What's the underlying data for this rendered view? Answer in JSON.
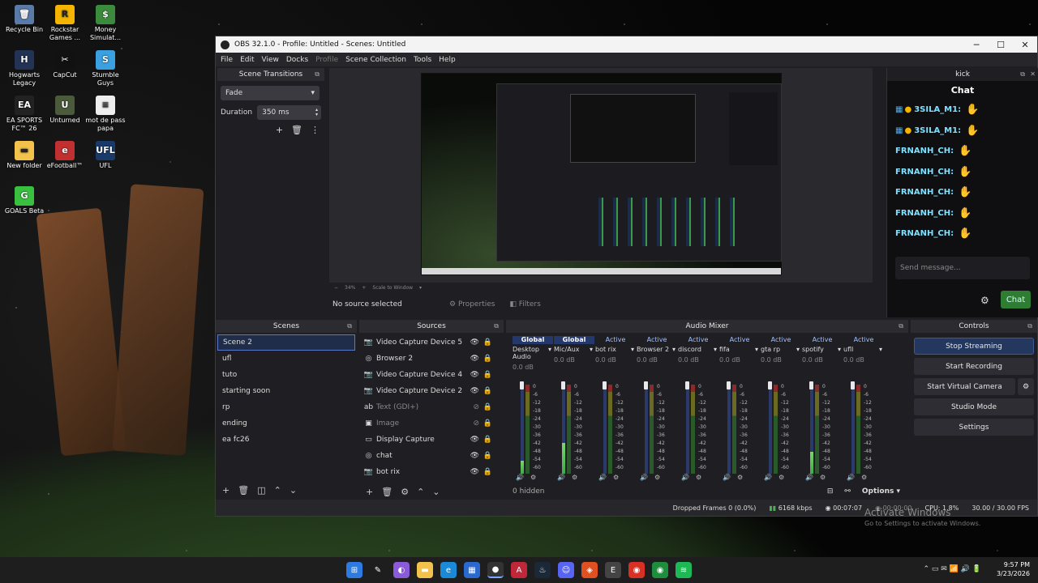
{
  "desktop": {
    "icons": [
      {
        "label": "Recycle Bin",
        "icon": "recycle-bin-icon",
        "color": "#5a7aa8",
        "glyph": "🗑"
      },
      {
        "label": "Rockstar Games ...",
        "icon": "rockstar-icon",
        "color": "#f4b400",
        "glyph": "R"
      },
      {
        "label": "Money Simulat...",
        "icon": "money-icon",
        "color": "#3c8a3c",
        "glyph": "$"
      },
      {
        "label": "Hogwarts Legacy",
        "icon": "hogwarts-icon",
        "color": "#223355",
        "glyph": "H"
      },
      {
        "label": "CapCut",
        "icon": "capcut-icon",
        "color": "#111111",
        "glyph": "✂"
      },
      {
        "label": "Stumble Guys",
        "icon": "stumble-icon",
        "color": "#3aa0e0",
        "glyph": "S"
      },
      {
        "label": "EA SPORTS FC™ 26",
        "icon": "ea-icon",
        "color": "#222222",
        "glyph": "EA"
      },
      {
        "label": "Unturned",
        "icon": "unturned-icon",
        "color": "#4a5a3a",
        "glyph": "U"
      },
      {
        "label": "mot de pass papa",
        "icon": "document-icon",
        "color": "#eeeeee",
        "glyph": "≡"
      },
      {
        "label": "New folder",
        "icon": "folder-icon",
        "color": "#f2c24c",
        "glyph": "▬"
      },
      {
        "label": "eFootball™",
        "icon": "efootball-icon",
        "color": "#c03030",
        "glyph": "e"
      },
      {
        "label": "UFL",
        "icon": "ufl-icon",
        "color": "#1a3a6a",
        "glyph": "UFL"
      },
      {
        "label": "GOALS Beta",
        "icon": "goals-icon",
        "color": "#3ac040",
        "glyph": "G"
      }
    ]
  },
  "window": {
    "title": "OBS 32.1.0 - Profile: Untitled - Scenes: Untitled",
    "controls": {
      "minimize": "─",
      "maximize": "☐",
      "close": "✕"
    }
  },
  "menu": [
    "File",
    "Edit",
    "View",
    "Docks",
    "Profile",
    "Scene Collection",
    "Tools",
    "Help"
  ],
  "transitions": {
    "title": "Scene Transitions",
    "type": "Fade",
    "duration_label": "Duration",
    "duration": "350 ms"
  },
  "preview": {
    "zoom": "34%",
    "scale_mode": "Scale to Window"
  },
  "context": {
    "no_source": "No source selected",
    "properties": "Properties",
    "filters": "Filters"
  },
  "scenes": {
    "title": "Scenes",
    "items": [
      "Scene 2",
      "ufl",
      "tuto",
      "starting soon",
      "rp",
      "ending",
      "ea fc26"
    ],
    "selected": 0
  },
  "sources": {
    "title": "Sources",
    "items": [
      {
        "name": "Video Capture Device 5",
        "icon": "camera-icon",
        "glyph": "📷",
        "visible": true
      },
      {
        "name": "Browser 2",
        "icon": "globe-icon",
        "glyph": "◎",
        "visible": true
      },
      {
        "name": "Video Capture Device 4",
        "icon": "camera-icon",
        "glyph": "📷",
        "visible": true
      },
      {
        "name": "Video Capture Device 2",
        "icon": "camera-icon",
        "glyph": "📷",
        "visible": true
      },
      {
        "name": "Text (GDI+)",
        "icon": "text-icon",
        "glyph": "ab",
        "visible": false
      },
      {
        "name": "Image",
        "icon": "image-icon",
        "glyph": "▣",
        "visible": false
      },
      {
        "name": "Display Capture",
        "icon": "display-icon",
        "glyph": "▭",
        "visible": true
      },
      {
        "name": "chat",
        "icon": "globe-icon",
        "glyph": "◎",
        "visible": true
      },
      {
        "name": "bot rix",
        "icon": "camera-icon",
        "glyph": "📷",
        "visible": true
      }
    ]
  },
  "mixer": {
    "title": "Audio Mixer",
    "hidden": "0 hidden",
    "options": "Options",
    "ticks": [
      "0",
      "-6",
      "-12",
      "-18",
      "-24",
      "-30",
      "-36",
      "-42",
      "-48",
      "-54",
      "-60"
    ],
    "channels": [
      {
        "badge": "Global",
        "name": "Desktop Audio",
        "db": "0.0 dB",
        "level": 0.15,
        "muted": true
      },
      {
        "badge": "Global",
        "name": "Mic/Aux",
        "db": "0.0 dB",
        "level": 0.35,
        "muted": false
      },
      {
        "badge": "Active",
        "name": "bot rix",
        "db": "0.0 dB",
        "level": 0.0,
        "muted": true
      },
      {
        "badge": "Active",
        "name": "Browser 2",
        "db": "0.0 dB",
        "level": 0.0,
        "muted": false
      },
      {
        "badge": "Active",
        "name": "discord",
        "db": "0.0 dB",
        "level": 0.0,
        "muted": false
      },
      {
        "badge": "Active",
        "name": "fifa",
        "db": "0.0 dB",
        "level": 0.0,
        "muted": false
      },
      {
        "badge": "Active",
        "name": "gta rp",
        "db": "0.0 dB",
        "level": 0.0,
        "muted": false
      },
      {
        "badge": "Active",
        "name": "spotify",
        "db": "0.0 dB",
        "level": 0.25,
        "muted": false
      },
      {
        "badge": "Active",
        "name": "ufll",
        "db": "0.0 dB",
        "level": 0.0,
        "muted": false
      }
    ]
  },
  "controls": {
    "title": "Controls",
    "stop_streaming": "Stop Streaming",
    "start_recording": "Start Recording",
    "virtual_camera": "Start Virtual Camera",
    "studio_mode": "Studio Mode",
    "settings": "Settings"
  },
  "status": {
    "dropped": "Dropped Frames 0 (0.0%)",
    "bitrate": "6168 kbps",
    "live_time": "00:07:07",
    "rec_time": "00:00:00",
    "cpu": "CPU: 1.8%",
    "fps": "30.00 / 30.00 FPS"
  },
  "kick": {
    "dock_title": "kick",
    "chat_title": "Chat",
    "placeholder": "Send message...",
    "send": "Chat",
    "messages": [
      {
        "user": "3SILA_M1:",
        "color": "#7ee0ff",
        "badges": true
      },
      {
        "user": "3SILA_M1:",
        "color": "#7ee0ff",
        "badges": true
      },
      {
        "user": "FRNANH_CH:",
        "color": "#7ee0ff",
        "badges": false
      },
      {
        "user": "FRNANH_CH:",
        "color": "#7ee0ff",
        "badges": false
      },
      {
        "user": "FRNANH_CH:",
        "color": "#7ee0ff",
        "badges": false
      },
      {
        "user": "FRNANH_CH:",
        "color": "#7ee0ff",
        "badges": false
      },
      {
        "user": "FRNANH_CH:",
        "color": "#7ee0ff",
        "badges": false
      }
    ]
  },
  "watermark": {
    "line1": "Activate Windows",
    "line2": "Go to Settings to activate Windows."
  },
  "system": {
    "time": "9:57 PM",
    "date": "3/23/2026"
  },
  "colors": {
    "accent": "#2e7d32",
    "selection": "#1f2d4a",
    "global_badge": "#24386c"
  }
}
